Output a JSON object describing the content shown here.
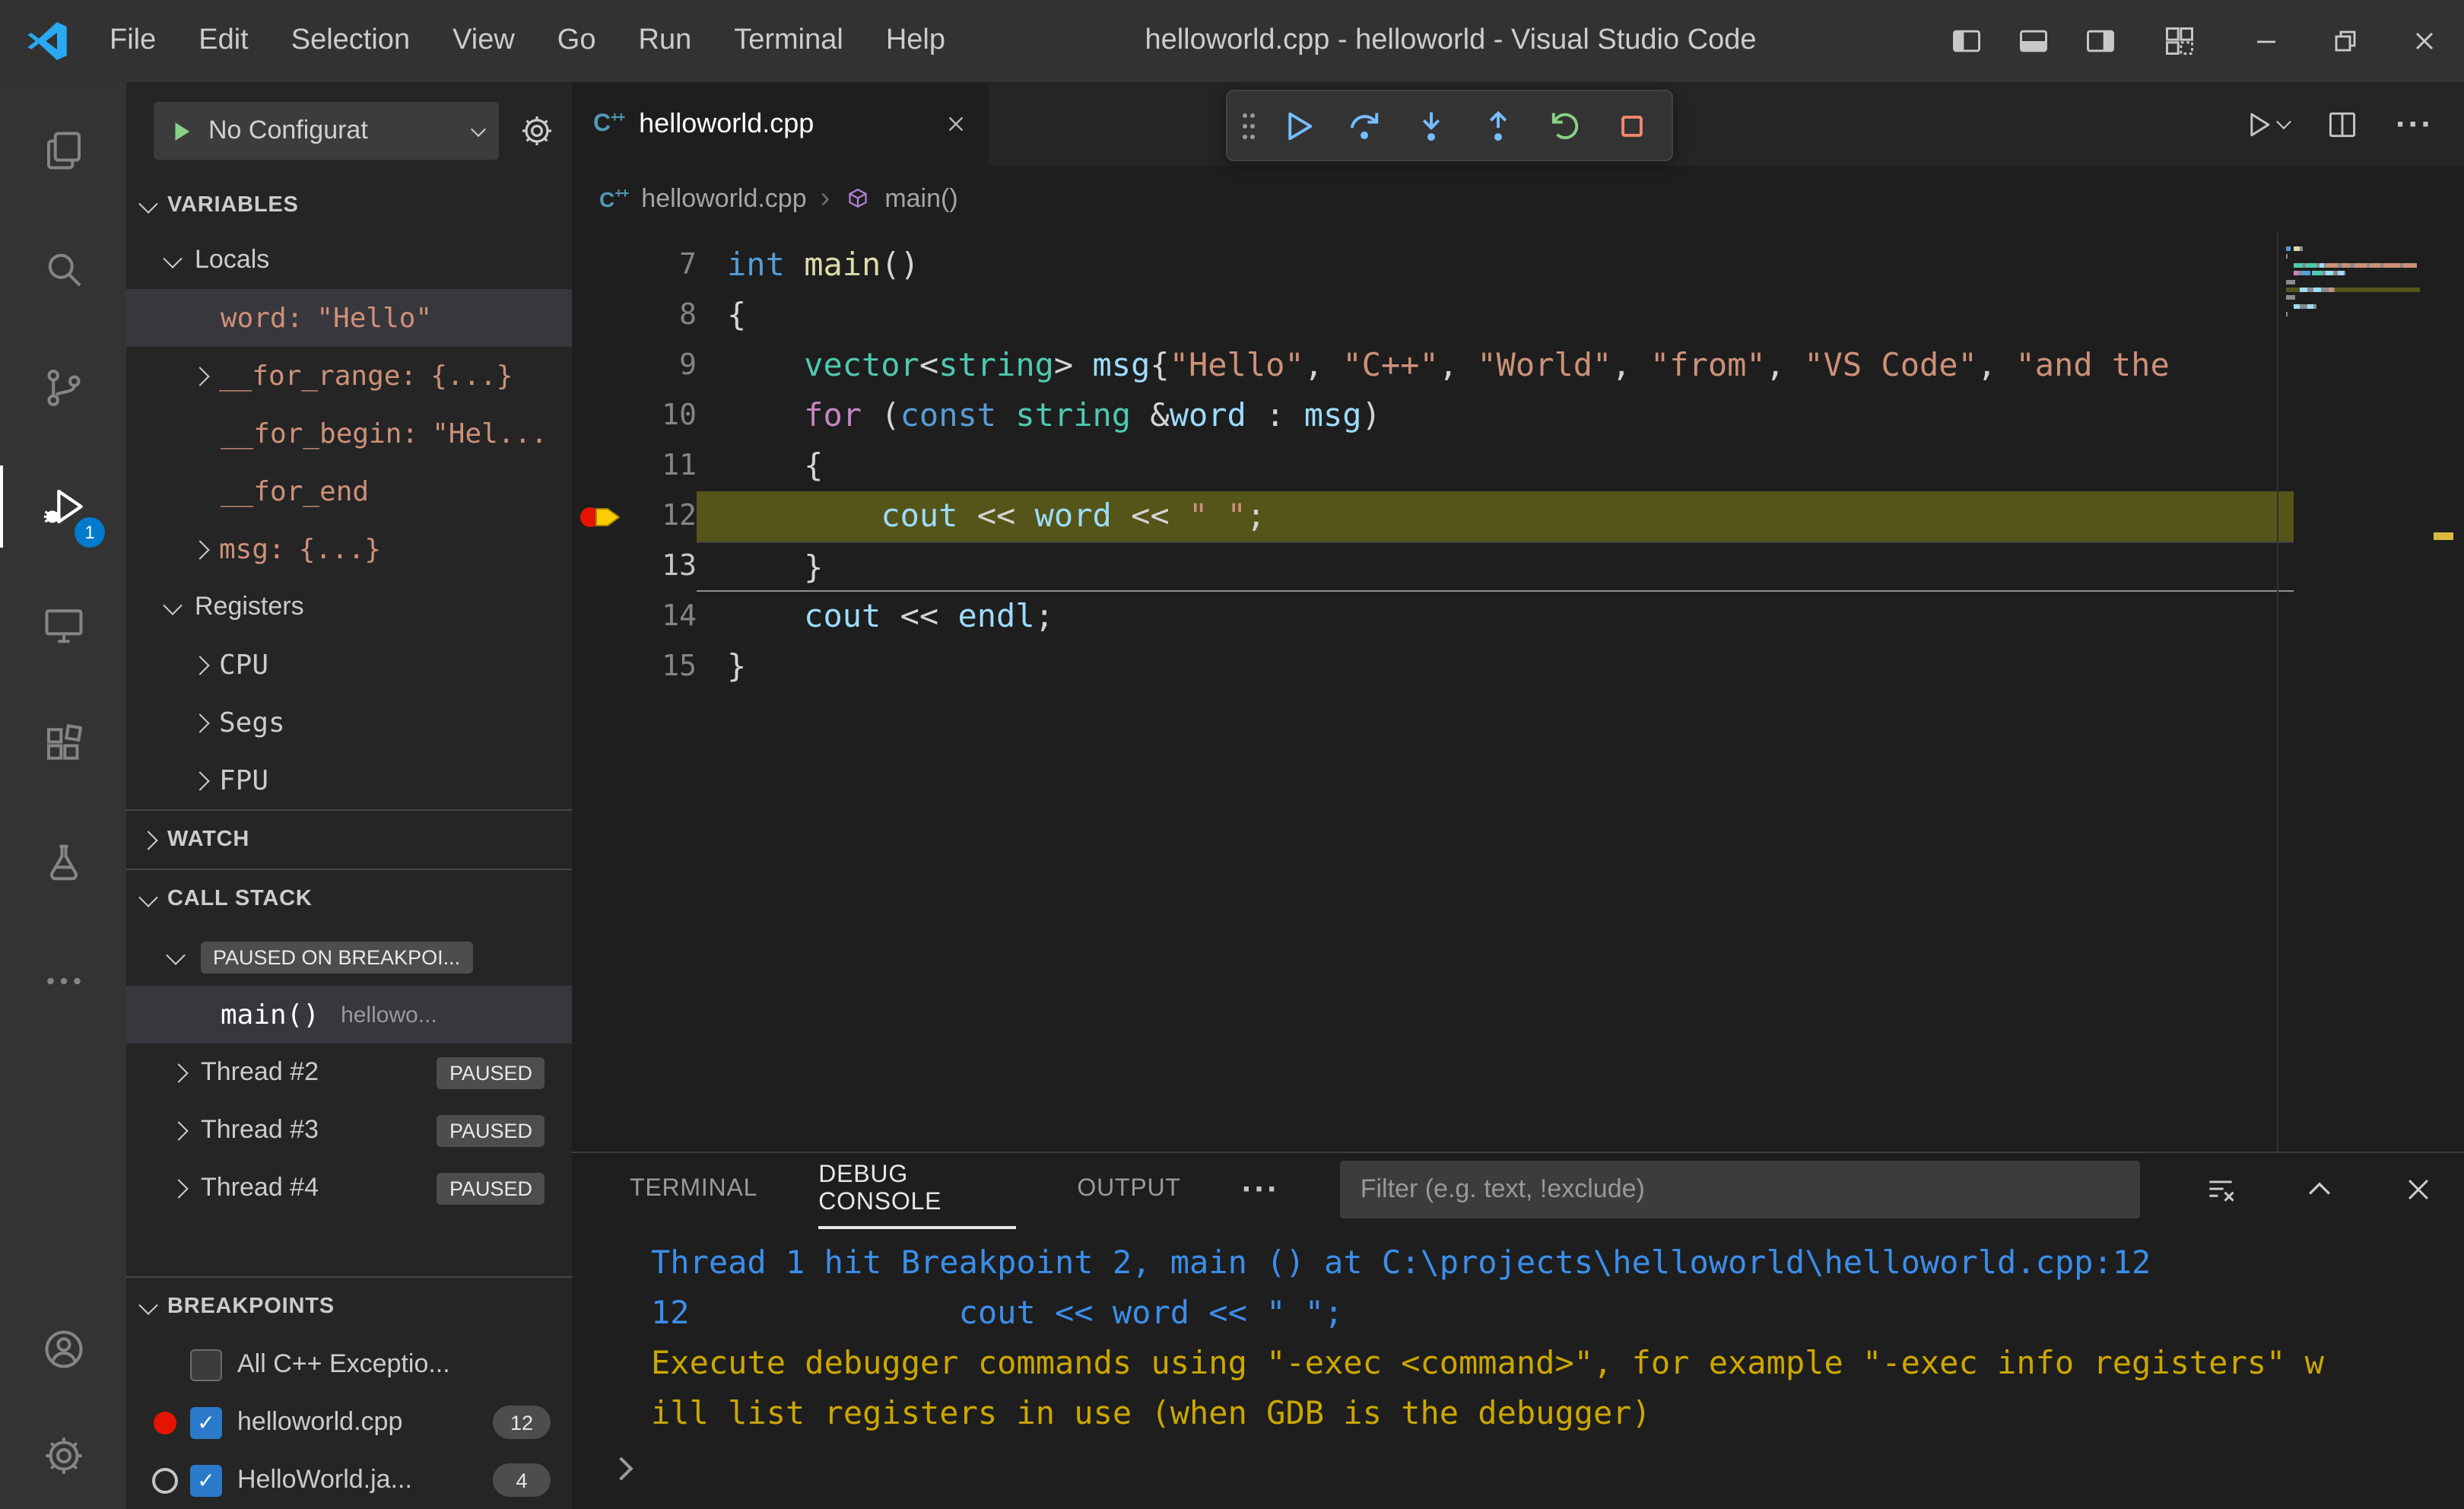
{
  "icons": {
    "check": "✓",
    "more": "···",
    "crumb_sep": "›",
    "cpp_c": "C",
    "cpp_pp": "++"
  },
  "titlebar": {
    "menus": [
      "File",
      "Edit",
      "Selection",
      "View",
      "Go",
      "Run",
      "Terminal",
      "Help"
    ],
    "title": "helloworld.cpp - helloworld - Visual Studio Code"
  },
  "activitybar": {
    "debug_badge": "1"
  },
  "sidebar": {
    "toolbar": {
      "config": "No Configurat"
    },
    "variables": {
      "header": "VARIABLES",
      "groups": [
        {
          "label": "Locals",
          "items": [
            {
              "name": "word:",
              "value": "\"Hello\"",
              "kind": "string",
              "selected": true
            },
            {
              "name": "__for_range:",
              "value": "{...}",
              "kind": "obj",
              "chevron": true
            },
            {
              "name": "__for_begin:",
              "value": "\"Hel...",
              "kind": "string"
            },
            {
              "name": "__for_end",
              "value": "",
              "kind": "obj"
            },
            {
              "name": "msg:",
              "value": "{...}",
              "kind": "obj",
              "chevron": true
            }
          ]
        },
        {
          "label": "Registers",
          "items": [
            {
              "name": "CPU",
              "value": "",
              "kind": "plain",
              "chevron": true
            },
            {
              "name": "Segs",
              "value": "",
              "kind": "plain",
              "chevron": true
            },
            {
              "name": "FPU",
              "value": "",
              "kind": "plain",
              "chevron": true
            }
          ]
        }
      ]
    },
    "watch": {
      "header": "WATCH"
    },
    "callstack": {
      "header": "CALL STACK",
      "status_badge": "PAUSED ON BREAKPOI...",
      "frames": [
        {
          "name": "main()",
          "detail": "hellowo...",
          "selected": true
        }
      ],
      "threads": [
        {
          "name": "Thread #2",
          "badge": "PAUSED"
        },
        {
          "name": "Thread #3",
          "badge": "PAUSED"
        },
        {
          "name": "Thread #4",
          "badge": "PAUSED"
        }
      ]
    },
    "breakpoints": {
      "header": "BREAKPOINTS",
      "items": [
        {
          "marker": "none",
          "checked": false,
          "label": "All C++ Exceptio...",
          "count": ""
        },
        {
          "marker": "dot",
          "checked": true,
          "label": "helloworld.cpp",
          "count": "12"
        },
        {
          "marker": "circle",
          "checked": true,
          "label": "HelloWorld.ja...",
          "count": "4"
        }
      ]
    }
  },
  "editor": {
    "tab": "helloworld.cpp",
    "breadcrumb": {
      "file": "helloworld.cpp",
      "symbol": "main()"
    },
    "code": {
      "lines": [
        {
          "n": "7",
          "tokens": [
            [
              "kw",
              "int"
            ],
            [
              "pl",
              " "
            ],
            [
              "fn",
              "main"
            ],
            [
              "pl",
              "()"
            ]
          ]
        },
        {
          "n": "8",
          "tokens": [
            [
              "pl",
              "{"
            ]
          ]
        },
        {
          "n": "9",
          "tokens": [
            [
              "pl",
              "    "
            ],
            [
              "type",
              "vector"
            ],
            [
              "pl",
              "<"
            ],
            [
              "type",
              "string"
            ],
            [
              "pl",
              "> "
            ],
            [
              "var",
              "msg"
            ],
            [
              "pl",
              "{"
            ],
            [
              "str",
              "\"Hello\""
            ],
            [
              "pl",
              ", "
            ],
            [
              "str",
              "\"C++\""
            ],
            [
              "pl",
              ", "
            ],
            [
              "str",
              "\"World\""
            ],
            [
              "pl",
              ", "
            ],
            [
              "str",
              "\"from\""
            ],
            [
              "pl",
              ", "
            ],
            [
              "str",
              "\"VS Code\""
            ],
            [
              "pl",
              ", "
            ],
            [
              "str",
              "\"and the"
            ]
          ]
        },
        {
          "n": "10",
          "tokens": [
            [
              "pl",
              "    "
            ],
            [
              "ctrl",
              "for"
            ],
            [
              "pl",
              " ("
            ],
            [
              "kw",
              "const"
            ],
            [
              "pl",
              " "
            ],
            [
              "type",
              "string"
            ],
            [
              "pl",
              " &"
            ],
            [
              "var",
              "word"
            ],
            [
              "pl",
              " : "
            ],
            [
              "var",
              "msg"
            ],
            [
              "pl",
              ")"
            ]
          ]
        },
        {
          "n": "11",
          "tokens": [
            [
              "pl",
              "    {"
            ]
          ]
        },
        {
          "n": "12",
          "current": true,
          "tokens": [
            [
              "pl",
              "        "
            ],
            [
              "var",
              "cout"
            ],
            [
              "pl",
              " << "
            ],
            [
              "var",
              "word"
            ],
            [
              "pl",
              " << "
            ],
            [
              "str",
              "\" \""
            ],
            [
              "pl",
              ";"
            ]
          ]
        },
        {
          "n": "13",
          "cursor": true,
          "tokens": [
            [
              "pl",
              "    }"
            ]
          ]
        },
        {
          "n": "14",
          "tokens": [
            [
              "pl",
              "    "
            ],
            [
              "var",
              "cout"
            ],
            [
              "pl",
              " << "
            ],
            [
              "var",
              "endl"
            ],
            [
              "pl",
              ";"
            ]
          ]
        },
        {
          "n": "15",
          "tokens": [
            [
              "pl",
              "}"
            ]
          ]
        }
      ]
    }
  },
  "panel": {
    "tabs": [
      {
        "label": "TERMINAL",
        "active": false
      },
      {
        "label": "DEBUG CONSOLE",
        "active": true
      },
      {
        "label": "OUTPUT",
        "active": false
      }
    ],
    "filter_placeholder": "Filter (e.g. text, !exclude)",
    "console": [
      {
        "color": "blue",
        "text": "Thread 1 hit Breakpoint 2, main () at C:\\projects\\helloworld\\helloworld.cpp:12"
      },
      {
        "color": "blue",
        "text": "12              cout << word << \" \";"
      },
      {
        "color": "yellow",
        "text": "Execute debugger commands using \"-exec <command>\", for example \"-exec info registers\" w"
      },
      {
        "color": "yellow",
        "text": "ill list registers in use (when GDB is the debugger)"
      }
    ]
  }
}
